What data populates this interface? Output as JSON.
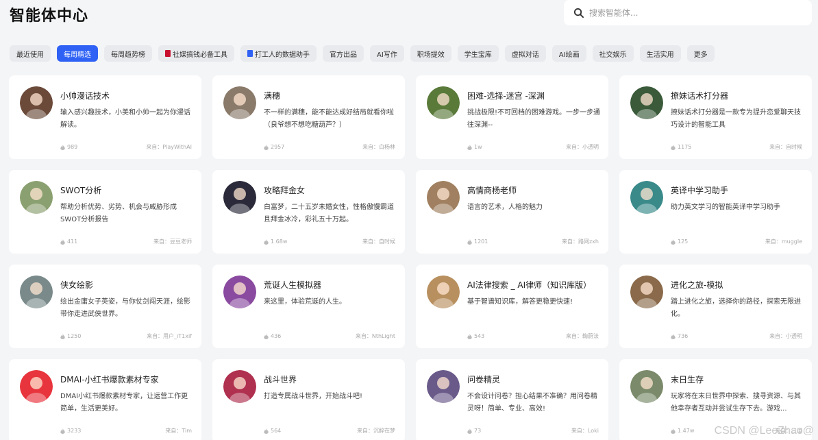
{
  "header": {
    "title": "智能体中心",
    "search_placeholder": "搜索智能体..."
  },
  "tabs": [
    {
      "label": "最近使用",
      "active": false,
      "icon": null
    },
    {
      "label": "每周精选",
      "active": true,
      "icon": null
    },
    {
      "label": "每周趋势榜",
      "active": false,
      "icon": null
    },
    {
      "label": "社媒搞钱必备工具",
      "active": false,
      "icon": "red-book-icon",
      "icon_color": "#c8102e"
    },
    {
      "label": "打工人的数据助手",
      "active": false,
      "icon": "bar-chart-icon",
      "icon_color": "#2f62f4"
    },
    {
      "label": "官方出品",
      "active": false,
      "icon": null
    },
    {
      "label": "AI写作",
      "active": false,
      "icon": null
    },
    {
      "label": "职场提效",
      "active": false,
      "icon": null
    },
    {
      "label": "学生宝库",
      "active": false,
      "icon": null
    },
    {
      "label": "虚拟对话",
      "active": false,
      "icon": null
    },
    {
      "label": "AI绘画",
      "active": false,
      "icon": null
    },
    {
      "label": "社交娱乐",
      "active": false,
      "icon": null
    },
    {
      "label": "生活实用",
      "active": false,
      "icon": null
    },
    {
      "label": "更多",
      "active": false,
      "icon": null
    }
  ],
  "cards": [
    {
      "title": "小帅漫话技术",
      "desc": "输入感兴趣技术，小美和小帅一起为你漫话解读。",
      "count": "989",
      "source": "来自：PlayWithAI",
      "avatar_color": "#6b4a3a"
    },
    {
      "title": "满穗",
      "desc": "不一样的满穗，能不能达成好结局就看你啦（良爷想不想吃糖葫芦？）",
      "count": "2957",
      "source": "来自：白杨林",
      "avatar_color": "#8a7a6a"
    },
    {
      "title": "困难-选择-迷宫 -深渊",
      "desc": "挑战极限!不可回档的困难游戏。一步一步通往深渊--",
      "count": "1w",
      "source": "来自：小透明",
      "avatar_color": "#5a7a3a"
    },
    {
      "title": "撩妹话术打分器",
      "desc": "撩妹话术打分器是一款专为提升恋爱聊天技巧设计的智能工具",
      "count": "1175",
      "source": "来自：自时候",
      "avatar_color": "#3a5a3a"
    },
    {
      "title": "SWOT分析",
      "desc": "帮助分析优势、劣势、机会与威胁形成SWOT分析报告",
      "count": "411",
      "source": "来自：豆豆老师",
      "avatar_color": "#8aa070"
    },
    {
      "title": "攻略拜金女",
      "desc": "白富梦，二十五岁未婚女性，性格傲慢霸道且拜金冰冷，彩礼五十万起。",
      "count": "1.68w",
      "source": "来自：自时候",
      "avatar_color": "#2a2a3a"
    },
    {
      "title": "高情商杨老师",
      "desc": "语言的艺术，人格的魅力",
      "count": "1201",
      "source": "来自：路网zxh",
      "avatar_color": "#a08060"
    },
    {
      "title": "英译中学习助手",
      "desc": "助力英文学习的智能英译中学习助手",
      "count": "125",
      "source": "来自：muggle",
      "avatar_color": "#3a8a8a"
    },
    {
      "title": "侠女绘影",
      "desc": "绘出金庸女子英姿，与你仗剑闯天涯，绘影带你走进武侠世界。",
      "count": "1250",
      "source": "来自：用户_iT1xif",
      "avatar_color": "#7a8a8a"
    },
    {
      "title": "荒诞人生模拟器",
      "desc": "来这里，体验荒诞的人生。",
      "count": "436",
      "source": "来自：NthLight",
      "avatar_color": "#8a4aa0"
    },
    {
      "title": "AI法律搜索 _ AI律师（知识库版）",
      "desc": "基于智谱知识库，解答更稳更快速!",
      "count": "543",
      "source": "来自：鞠蔚法",
      "avatar_color": "#b89060"
    },
    {
      "title": "进化之旅-模拟",
      "desc": "踏上进化之旅，选择你的路径，探索无限进化。",
      "count": "736",
      "source": "来自：小透明",
      "avatar_color": "#8a6a4a"
    },
    {
      "title": "DMAI-小红书爆款素材专家",
      "desc": "DMAI小红书爆款素材专家，让运营工作更简单，生活更美好。",
      "count": "3233",
      "source": "来自：Tim",
      "avatar_color": "#e8343c"
    },
    {
      "title": "战斗世界",
      "desc": "打造专属战斗世界，开始战斗吧!",
      "count": "564",
      "source": "来自：沉醉在梦",
      "avatar_color": "#b03050"
    },
    {
      "title": "问卷精灵",
      "desc": "不会设计问卷？担心结果不准确？用问卷精灵呀！简单、专业、高效!",
      "count": "73",
      "source": "来自：Loki",
      "avatar_color": "#6a5a8a"
    },
    {
      "title": "末日生存",
      "desc": "玩家将在末日世界中探索、搜寻资源、与其他幸存者互动并尝试生存下去。游戏...",
      "count": "1.47w",
      "source": "来自：三道",
      "avatar_color": "#7a8a6a"
    }
  ],
  "watermark": "CSDN @LeeZhao@"
}
